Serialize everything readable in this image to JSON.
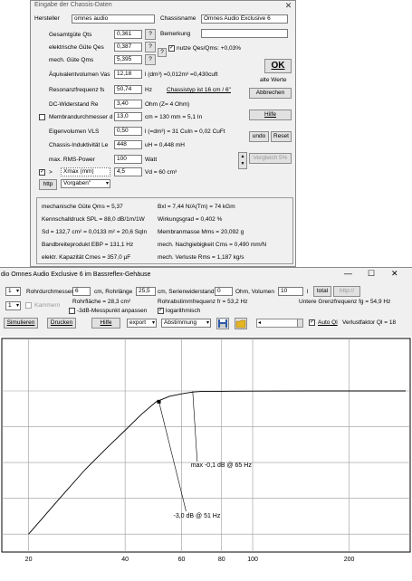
{
  "dialog": {
    "title": "Eingabe der Chassis-Daten",
    "close_glyph": "✕",
    "hersteller_label": "Hersteller",
    "hersteller_value": "omnes audio",
    "chassisname_label": "Chassisname",
    "chassisname_value": "Omnes Audio Exclusive 6",
    "bemerkung_label": "Bemerkung",
    "bemerkung_value": "",
    "rows": [
      {
        "label": "Gesamtgüte Qts",
        "value": "0,361",
        "unit": "?"
      },
      {
        "label": "elektrische Güte Qes",
        "value": "0,387",
        "unit": "?"
      },
      {
        "label": "mech. Güte Qms",
        "value": "5,395",
        "unit": "?"
      },
      {
        "label": "Äquivalentvolumen Vas",
        "value": "12,18",
        "unit": "l (dm³) =0,012m³ =0,430cuft"
      },
      {
        "label": "Resonanzfrequenz fs",
        "value": "50,74",
        "unit": "Hz"
      },
      {
        "label": "DC-Widerstand Re",
        "value": "3,40",
        "unit": "Ohm (Z= 4 Ohm)"
      },
      {
        "label": "Membrandurchmesser d",
        "value": "13,0",
        "unit": "cm = 130 mm = 5,1 In"
      },
      {
        "label": "Eigenvolumen VLS",
        "value": "0,50",
        "unit": "l (=dm³) = 31 CuIn = 0,02 CuFt"
      },
      {
        "label": "Chassis-Induktivität Le",
        "value": "448",
        "unit": "uH = 0,448 mH"
      },
      {
        "label": "max. RMS-Power",
        "value": "100",
        "unit": "Watt"
      },
      {
        "label": "Xmax (mm)",
        "value": "4,5",
        "unit": "Vd = 60 cm³"
      }
    ],
    "q_button": "?",
    "nutze_q_label": "nutze Qes/Qms: +0,03%",
    "chassistyp_link": "Chassistyp ist 16 cm / 6\"",
    "ok_label": "OK",
    "alte_werte_label": "alte Werte",
    "abbrechen_label": "Abbrechen",
    "hilfe_label": "Hilfe",
    "undo_label": "undo",
    "reset_label": "Reset",
    "vergleich_label": "Vergleich 5%",
    "chk_arrow": ">",
    "http_label": "http",
    "vorgaben_value": "Vorgaben\"",
    "info": [
      [
        "mechanische Güte Qms = 5,37",
        "Bxl = 7,44 N/A(Tm) = 74 kGm"
      ],
      [
        "Kennschalldruck SPL = 88,0 dB/1m/1W",
        "Wirkungsgrad = 0,402 %"
      ],
      [
        "Sd = 132,7 cm² = 0,0133 m² = 20,6 SqIn",
        "Membranmasse Mms = 20,092 g"
      ],
      [
        "Bandbreiteprodukt EBP = 131,1 Hz",
        "mech. Nachgiebigkeit Cms = 0,490 mm/N"
      ],
      [
        "elektr. Kapazität Cmes = 357,0 µF",
        "mech. Verluste Rms = 1,187 kg/s"
      ]
    ]
  },
  "main": {
    "title": "dio Omnes Audio Exclusive 6 im Bassreflex-Gehäuse",
    "minimize": "—",
    "maximize": "☐",
    "close": "✕",
    "rohrzahl": "1",
    "rohrdurchmesser_label": "Rohrdurchmesser",
    "rohrdurchmesser_value": "6",
    "rohrlaenge_label": "cm, Rohrlänge",
    "rohrlaenge_value": "25,5",
    "serienwiderstand_label": "cm, Serienwiderstand",
    "serienwiderstand_value": "0",
    "volumen_label": "Ohm, Volumen",
    "volumen_value": "10",
    "volumen_unit": "l",
    "total_label": "total",
    "http_label": "http://",
    "rohrflaeche": "Rohrfläche = 28,3 cm²",
    "abstimm": "Rohrabstimmfrequenz fr = 53,2 Hz",
    "grenz": "Untere Grenzfrequenz fg = 54,9 Hz",
    "kammern_value": "1",
    "kammern_label": "Kammern",
    "messpunkt_label": "-3dB-Messpunkt anpassen",
    "log_label": "logarithmisch",
    "simulieren": "Simulieren",
    "drucken": "Drucken",
    "hilfe": "Hilfe",
    "export": "export",
    "abstimmung": "Abstimmung",
    "auto_ql": "Auto Ql",
    "verlust": "Verlustfaktor Ql = 18"
  },
  "chart_data": {
    "type": "line",
    "x_scale": "log",
    "x_ticks": [
      "20",
      "40",
      "60",
      "80",
      "100",
      "200"
    ],
    "x": [
      20,
      25,
      30,
      35,
      40,
      45,
      50,
      55,
      60,
      65,
      70,
      80,
      100,
      150,
      200,
      300
    ],
    "y": [
      -40,
      -30,
      -22,
      -16,
      -11,
      -6.5,
      -3.0,
      -1.5,
      -0.8,
      -0.3,
      -0.1,
      -0.1,
      -0.05,
      0,
      0,
      0
    ],
    "annotations": [
      "max -0,1 dB @ 65 Hz",
      "-3,0 dB @ 51 Hz"
    ],
    "grid": true
  }
}
